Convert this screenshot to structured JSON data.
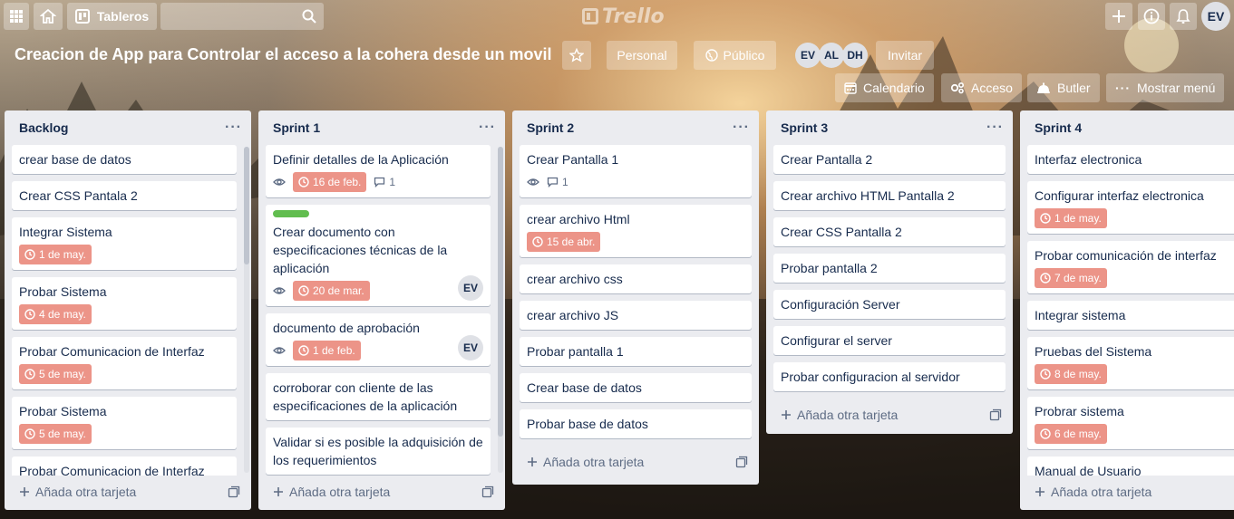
{
  "topbar": {
    "boards_label": "Tableros",
    "search_placeholder": "",
    "logo_text": "Trello",
    "user_initials": "EV"
  },
  "board": {
    "title": "Creacion de App para Controlar el acceso a la cohera desde un movil",
    "team_label": "Personal",
    "visibility_label": "Público",
    "members": [
      "EV",
      "AL",
      "DH"
    ],
    "invite_label": "Invitar",
    "menu": {
      "calendar": "Calendario",
      "access": "Acceso",
      "butler": "Butler",
      "more": "Mostrar menú"
    }
  },
  "add_card_label": "Añada otra tarjeta",
  "lists": [
    {
      "title": "Backlog",
      "cards": [
        {
          "title": "crear base de datos"
        },
        {
          "title": "Crear CSS Pantala 2"
        },
        {
          "title": "Integrar Sistema",
          "due": "1 de may."
        },
        {
          "title": "Probar Sistema",
          "due": "4 de may."
        },
        {
          "title": "Probar Comunicacion de Interfaz",
          "due": "5 de may."
        },
        {
          "title": "Probar Sistema",
          "due": "5 de may."
        },
        {
          "title": "Probar Comunicacion de Interfaz"
        }
      ]
    },
    {
      "title": "Sprint 1",
      "cards": [
        {
          "title": "Definir detalles de la Aplicación",
          "due": "16 de feb.",
          "comments": "1"
        },
        {
          "title": "Crear documento con especificaciones técnicas de la aplicación",
          "due": "20 de mar.",
          "label_color": "#61bd4f",
          "member": "EV"
        },
        {
          "title": "documento de aprobación",
          "due": "1 de feb.",
          "member": "EV"
        },
        {
          "title": "corroborar con cliente de las especificaciones de la aplicación"
        },
        {
          "title": "Validar si es posible la adquisición de los requerimientos"
        }
      ]
    },
    {
      "title": "Sprint 2",
      "cards": [
        {
          "title": "Crear Pantalla 1",
          "comments": "1"
        },
        {
          "title": "crear archivo Html",
          "due": "15 de abr."
        },
        {
          "title": "crear archivo css"
        },
        {
          "title": "crear archivo JS"
        },
        {
          "title": "Probar pantalla 1"
        },
        {
          "title": "Crear base de datos"
        },
        {
          "title": "Probar base de datos"
        }
      ]
    },
    {
      "title": "Sprint 3",
      "cards": [
        {
          "title": "Crear Pantalla 2"
        },
        {
          "title": "Crear archivo HTML Pantalla 2"
        },
        {
          "title": "Crear CSS Pantalla 2"
        },
        {
          "title": "Probar pantalla 2"
        },
        {
          "title": "Configuración Server"
        },
        {
          "title": "Configurar el server"
        },
        {
          "title": "Probar configuracion al servidor"
        }
      ]
    },
    {
      "title": "Sprint 4",
      "cards": [
        {
          "title": "Interfaz electronica"
        },
        {
          "title": "Configurar interfaz electronica",
          "due": "1 de may."
        },
        {
          "title": "Probar comunicación de interfaz",
          "due": "7 de may."
        },
        {
          "title": "Integrar sistema"
        },
        {
          "title": "Pruebas del Sistema",
          "due": "8 de may."
        },
        {
          "title": "Probrar sistema",
          "due": "6 de may."
        },
        {
          "title": "Manual de Usuario"
        }
      ]
    }
  ]
}
